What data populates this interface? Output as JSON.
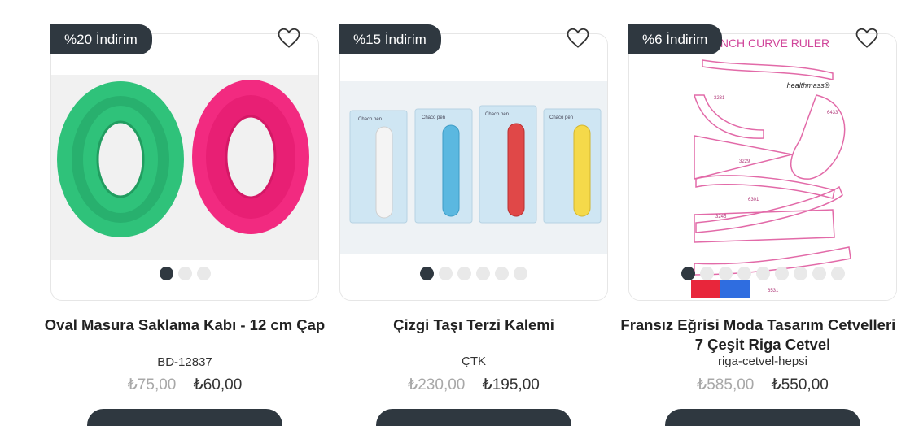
{
  "products": [
    {
      "badge": "%20 İndirim",
      "title": "Oval Masura Saklama Kabı - 12 cm Çap",
      "sku": "BD-12837",
      "old_price": "₺75,00",
      "new_price": "₺60,00",
      "image_dots": 3,
      "active_dot": 1
    },
    {
      "badge": "%15 İndirim",
      "title": "Çizgi Taşı Terzi Kalemi",
      "sku": "ÇTK",
      "old_price": "₺230,00",
      "new_price": "₺195,00",
      "image_dots": 6,
      "active_dot": 1,
      "package_label": "Chaco pen",
      "pen_colors": [
        "#f4f4f4",
        "#5bb8e0",
        "#e04848",
        "#f5d94a"
      ]
    },
    {
      "badge": "%6 İndirim",
      "title": "Fransız Eğrisi Moda Tasarım Cetvelleri - 7 Çeşit Riga Cetvel",
      "sku": "riga-cetvel-hepsi",
      "old_price": "₺585,00",
      "new_price": "₺550,00",
      "image_dots": 9,
      "active_dot": 1,
      "image_heading": "FRENCH CURVE RULER",
      "image_brand": "healthmass®",
      "ruler_numbers": [
        "3231",
        "6433",
        "3229",
        "6301",
        "3245",
        "6531"
      ]
    }
  ],
  "colors": {
    "badge_bg": "#2f3840",
    "oval_green": "#2fc27a",
    "oval_pink": "#f22a80",
    "ruler_pink": "#e26aa8"
  }
}
